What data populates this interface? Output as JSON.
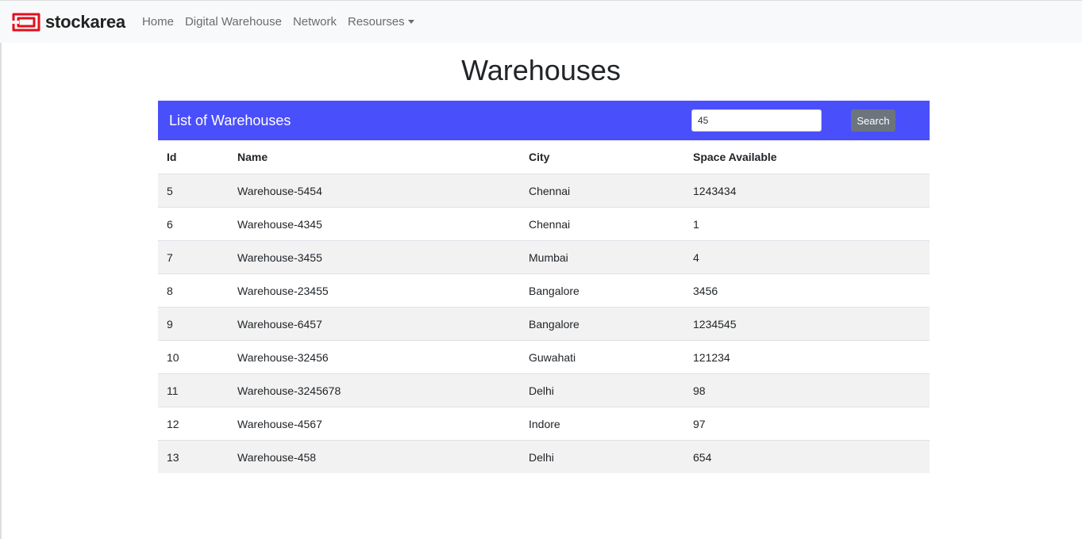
{
  "nav": {
    "brand": "stockarea",
    "links": [
      "Home",
      "Digital Warehouse",
      "Network",
      "Resourses"
    ]
  },
  "page": {
    "title": "Warehouses"
  },
  "card": {
    "title": "List of Warehouses",
    "search": {
      "value": "45",
      "button": "Search"
    }
  },
  "table": {
    "headers": [
      "Id",
      "Name",
      "City",
      "Space Available"
    ],
    "rows": [
      [
        "5",
        "Warehouse-5454",
        "Chennai",
        "1243434"
      ],
      [
        "6",
        "Warehouse-4345",
        "Chennai",
        "1"
      ],
      [
        "7",
        "Warehouse-3455",
        "Mumbai",
        "4"
      ],
      [
        "8",
        "Warehouse-23455",
        "Bangalore",
        "3456"
      ],
      [
        "9",
        "Warehouse-6457",
        "Bangalore",
        "1234545"
      ],
      [
        "10",
        "Warehouse-32456",
        "Guwahati",
        "121234"
      ],
      [
        "11",
        "Warehouse-3245678",
        "Delhi",
        "98"
      ],
      [
        "12",
        "Warehouse-4567",
        "Indore",
        "97"
      ],
      [
        "13",
        "Warehouse-458",
        "Delhi",
        "654"
      ]
    ]
  },
  "colors": {
    "accent": "#4a4ffc",
    "brand_red": "#e3101e",
    "button": "#6c757d"
  }
}
